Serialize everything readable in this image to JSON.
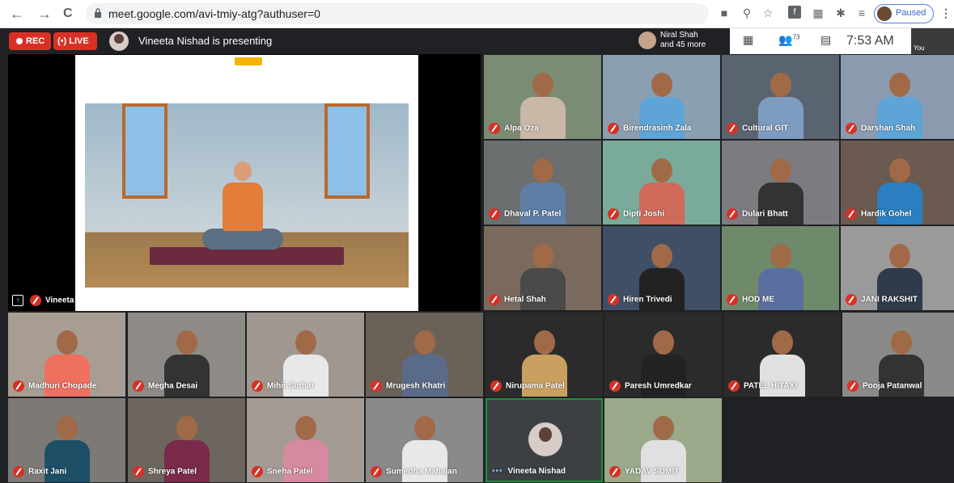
{
  "browser": {
    "back": "←",
    "forward": "→",
    "reload": "C",
    "url": "meet.google.com/avi-tmiy-atg?authuser=0",
    "paused_label": "Paused"
  },
  "meet": {
    "rec_label": "REC",
    "live_label": "(•) LIVE",
    "presenting_text": "Vineeta Nishad is presenting",
    "others_line1": "Niral Shah",
    "others_line2": "and 45 more",
    "people_count": "73",
    "time": "7:53 AM",
    "you_label": "You",
    "presenter_tile_name": "Vineeta Nishad"
  },
  "participants": [
    {
      "name": "Alpa Oza",
      "muted": true
    },
    {
      "name": "Birendrasinh Zala",
      "muted": true
    },
    {
      "name": "Cultural GIT",
      "muted": true
    },
    {
      "name": "Darshan Shah",
      "muted": true
    },
    {
      "name": "Dhaval P. Patel",
      "muted": true
    },
    {
      "name": "Dipti Joshi",
      "muted": true
    },
    {
      "name": "Dulari Bhatt",
      "muted": true
    },
    {
      "name": "Hardik Gohel",
      "muted": true
    },
    {
      "name": "Hetal Shah",
      "muted": true
    },
    {
      "name": "Hiren Trivedi",
      "muted": true
    },
    {
      "name": "HOD ME",
      "muted": true
    },
    {
      "name": "JANI RAKSHIT",
      "muted": true
    },
    {
      "name": "Madhuri Chopade",
      "muted": true
    },
    {
      "name": "Megha Desai",
      "muted": true
    },
    {
      "name": "Mihir Suthar",
      "muted": true
    },
    {
      "name": "Mrugesh Khatri",
      "muted": true
    },
    {
      "name": "Nirupama Patel",
      "muted": true
    },
    {
      "name": "Paresh Umredkar",
      "muted": true
    },
    {
      "name": "PATEL HITAXI",
      "muted": true
    },
    {
      "name": "Pooja Patanwal",
      "muted": true
    },
    {
      "name": "Raxit Jani",
      "muted": true
    },
    {
      "name": "Shreya Patel",
      "muted": true
    },
    {
      "name": "Sneha Patel",
      "muted": true
    },
    {
      "name": "Sumedha Mahajan",
      "muted": true
    },
    {
      "name": "Vineeta Nishad",
      "muted": false
    },
    {
      "name": "YADAV SUMIT",
      "muted": true
    }
  ],
  "colors": {
    "rec_red": "#d93025",
    "meet_bg": "#202124",
    "active_speaker_border": "#1e8e3e"
  }
}
